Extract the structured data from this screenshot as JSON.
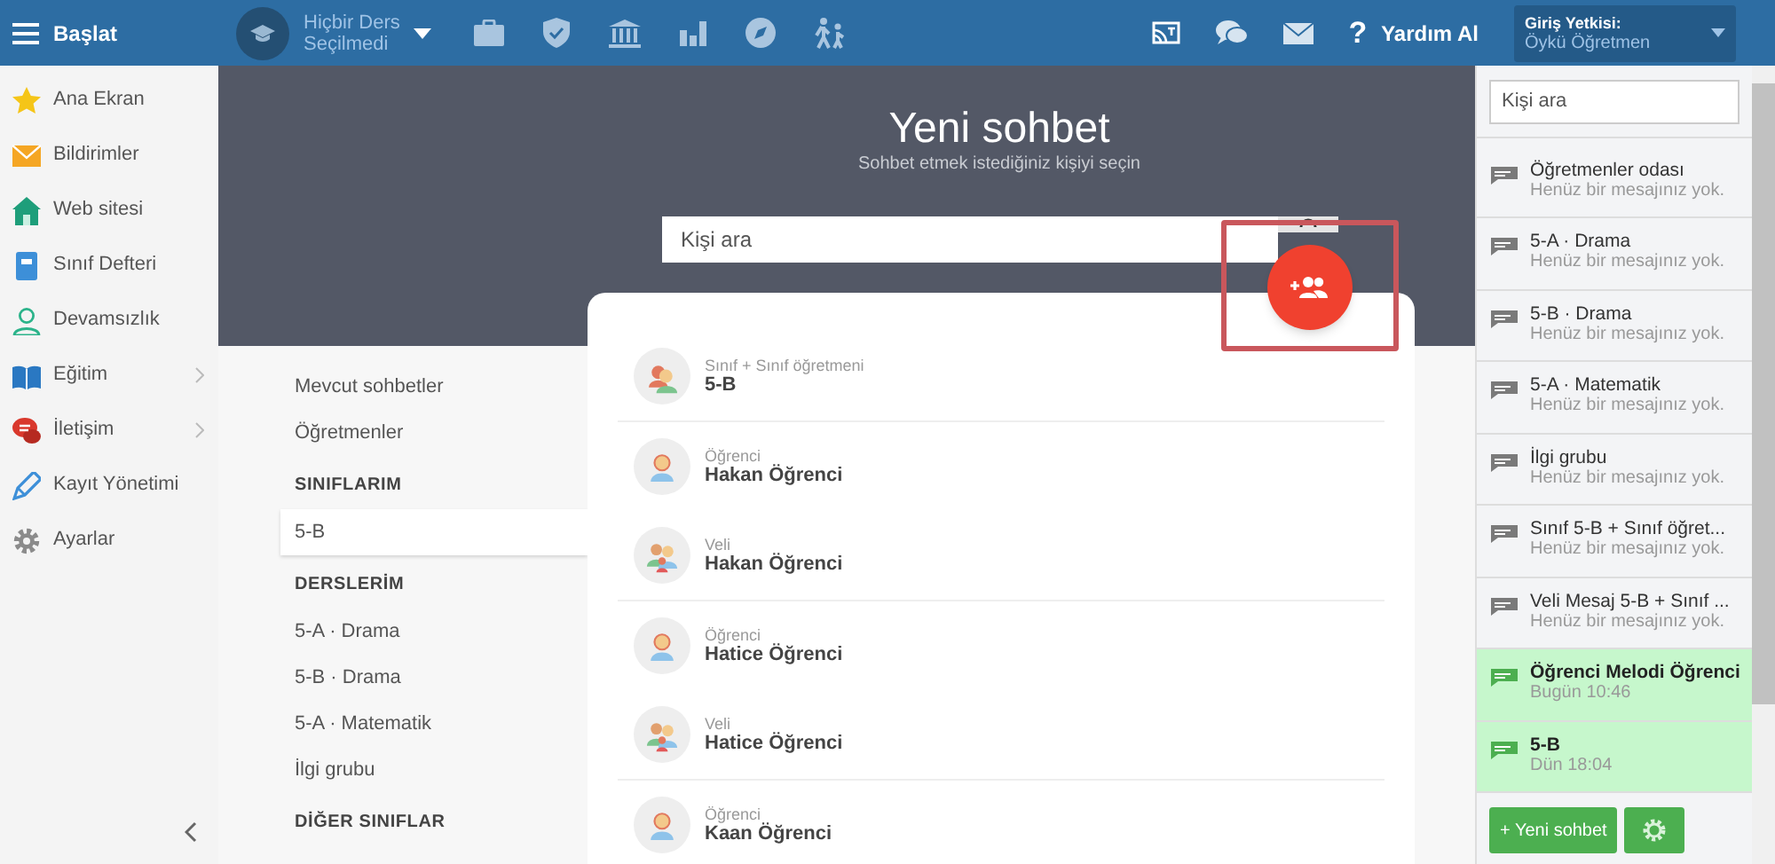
{
  "topbar": {
    "menu_label": "Başlat",
    "course_selector": "Hiçbir Ders Seçilmedi",
    "help_icon": "?",
    "help": "Yardım Al",
    "login_label": "Giriş Yetkisi:",
    "login_user": "Öykü Öğretmen"
  },
  "sidebar": {
    "items": [
      {
        "label": "Ana Ekran",
        "has_submenu": false
      },
      {
        "label": "Bildirimler",
        "has_submenu": false
      },
      {
        "label": "Web sitesi",
        "has_submenu": false
      },
      {
        "label": "Sınıf Defteri",
        "has_submenu": false
      },
      {
        "label": "Devamsızlık",
        "has_submenu": false
      },
      {
        "label": "Eğitim",
        "has_submenu": true
      },
      {
        "label": "İletişim",
        "has_submenu": true
      },
      {
        "label": "Kayıt Yönetimi",
        "has_submenu": false
      },
      {
        "label": "Ayarlar",
        "has_submenu": false
      }
    ]
  },
  "header": {
    "title": "Yeni sohbet",
    "subtitle": "Sohbet etmek istediğiniz kişiyi seçin",
    "search_placeholder": "Kişi ara"
  },
  "nav": [
    {
      "kind": "item",
      "label": "Mevcut sohbetler",
      "selected": false
    },
    {
      "kind": "item",
      "label": "Öğretmenler",
      "selected": false
    },
    {
      "kind": "heading",
      "label": "SINIFLARIM"
    },
    {
      "kind": "item",
      "label": "5-B",
      "selected": true
    },
    {
      "kind": "heading",
      "label": "DERSLERİM"
    },
    {
      "kind": "item",
      "label": "5-A · Drama",
      "selected": false
    },
    {
      "kind": "item",
      "label": "5-B · Drama",
      "selected": false
    },
    {
      "kind": "item",
      "label": "5-A · Matematik",
      "selected": false
    },
    {
      "kind": "item",
      "label": "İlgi grubu",
      "selected": false
    },
    {
      "kind": "heading",
      "label": "DİĞER SINIFLAR"
    }
  ],
  "contact_groups": [
    {
      "contacts": [
        {
          "kind": "class",
          "role": "Sınıf + Sınıf öğretmeni",
          "name": "5-B"
        }
      ]
    },
    {
      "contacts": [
        {
          "kind": "student",
          "role": "Öğrenci",
          "name": "Hakan Öğrenci"
        },
        {
          "kind": "parent",
          "role": "Veli",
          "name": "Hakan Öğrenci"
        }
      ]
    },
    {
      "contacts": [
        {
          "kind": "student",
          "role": "Öğrenci",
          "name": "Hatice Öğrenci"
        },
        {
          "kind": "parent",
          "role": "Veli",
          "name": "Hatice Öğrenci"
        }
      ]
    },
    {
      "contacts": [
        {
          "kind": "student",
          "role": "Öğrenci",
          "name": "Kaan Öğrenci"
        }
      ]
    }
  ],
  "chat_panel": {
    "search_placeholder": "Kişi ara",
    "new_chat_button": "+ Yeni sohbet",
    "conversations": [
      {
        "title": "Öğretmenler odası",
        "subtitle": "Henüz bir mesajınız yok.",
        "unread": false
      },
      {
        "title": "5-A · Drama",
        "subtitle": "Henüz bir mesajınız yok.",
        "unread": false
      },
      {
        "title": "5-B · Drama",
        "subtitle": "Henüz bir mesajınız yok.",
        "unread": false
      },
      {
        "title": "5-A · Matematik",
        "subtitle": "Henüz bir mesajınız yok.",
        "unread": false
      },
      {
        "title": "İlgi grubu",
        "subtitle": "Henüz bir mesajınız yok.",
        "unread": false
      },
      {
        "title": "Sınıf 5-B + Sınıf öğret...",
        "subtitle": "Henüz bir mesajınız yok.",
        "unread": false
      },
      {
        "title": "Veli Mesaj 5-B + Sınıf ...",
        "subtitle": "Henüz bir mesajınız yok.",
        "unread": false
      },
      {
        "title": "Öğrenci Melodi Öğrenci",
        "subtitle": "Bugün 10:46",
        "unread": true
      },
      {
        "title": "5-B",
        "subtitle": "Dün 18:04",
        "unread": true
      }
    ]
  }
}
